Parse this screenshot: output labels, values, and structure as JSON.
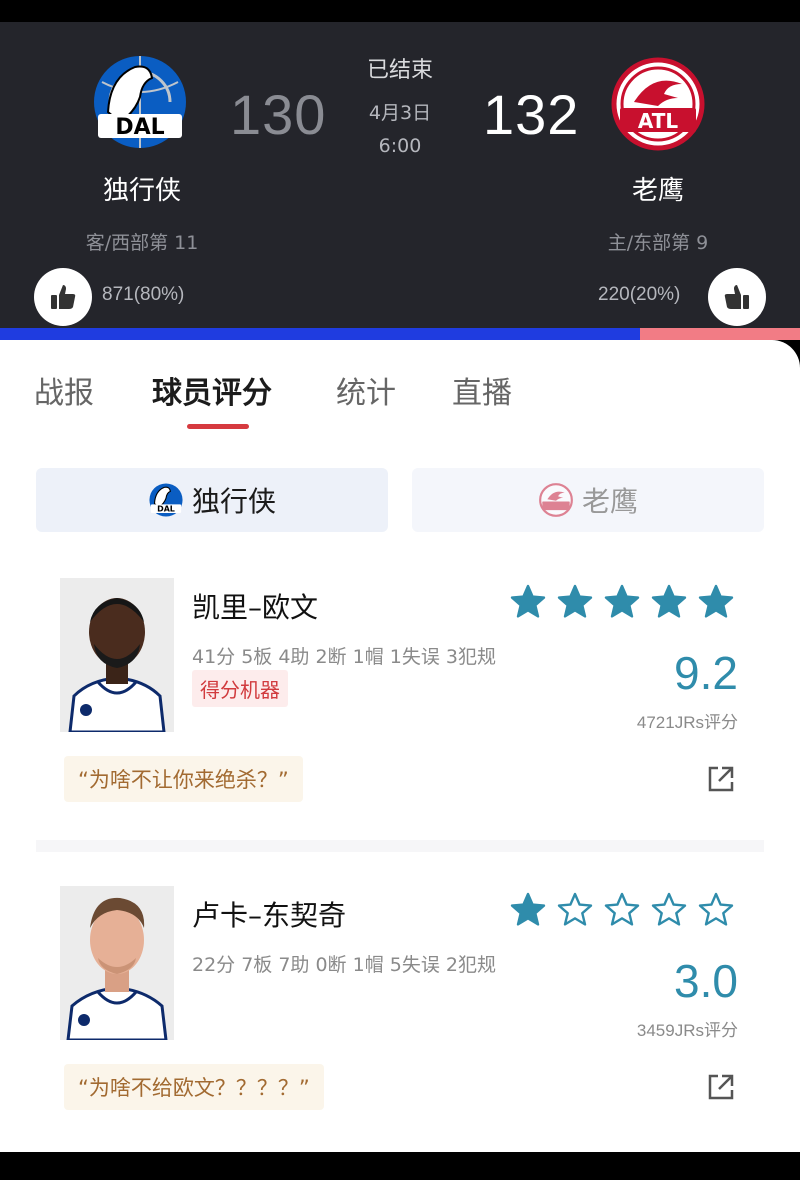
{
  "game": {
    "status": "已结束",
    "date": "4月3日",
    "time": "6:00",
    "away": {
      "name": "独行侠",
      "abbr": "DAL",
      "score": "130",
      "rank": "客/西部第 11",
      "votes": "871(80%)",
      "vote_fraction": 0.8,
      "color": "#1f3ce0"
    },
    "home": {
      "name": "老鹰",
      "abbr": "ATL",
      "score": "132",
      "rank": "主/东部第 9",
      "votes": "220(20%)",
      "vote_fraction": 0.2,
      "color": "#f27c85"
    }
  },
  "tabs": [
    {
      "label": "战报",
      "active": false
    },
    {
      "label": "球员评分",
      "active": true
    },
    {
      "label": "统计",
      "active": false
    },
    {
      "label": "直播",
      "active": false
    }
  ],
  "team_switch": {
    "selected": "独行侠",
    "other": "老鹰"
  },
  "players": [
    {
      "name": "凯里–欧文",
      "stats": "41分 5板 4助 2断 1帽 1失误 3犯规",
      "tag": "得分机器",
      "stars": 5,
      "rating": "9.2",
      "votes": "4721JRs评分",
      "quote": "“为啥不让你来绝杀？”",
      "jersey": "chime"
    },
    {
      "name": "卢卡–东契奇",
      "stats": "22分 7板 7助 0断 1帽 5失误 2犯规",
      "tag": "",
      "stars": 1,
      "rating": "3.0",
      "votes": "3459JRs评分",
      "quote": "“为啥不给欧文？？？？”",
      "jersey": "chime"
    }
  ],
  "colors": {
    "accent": "#d63a3f",
    "star": "#2f8cab",
    "header_bg": "#24252b"
  }
}
